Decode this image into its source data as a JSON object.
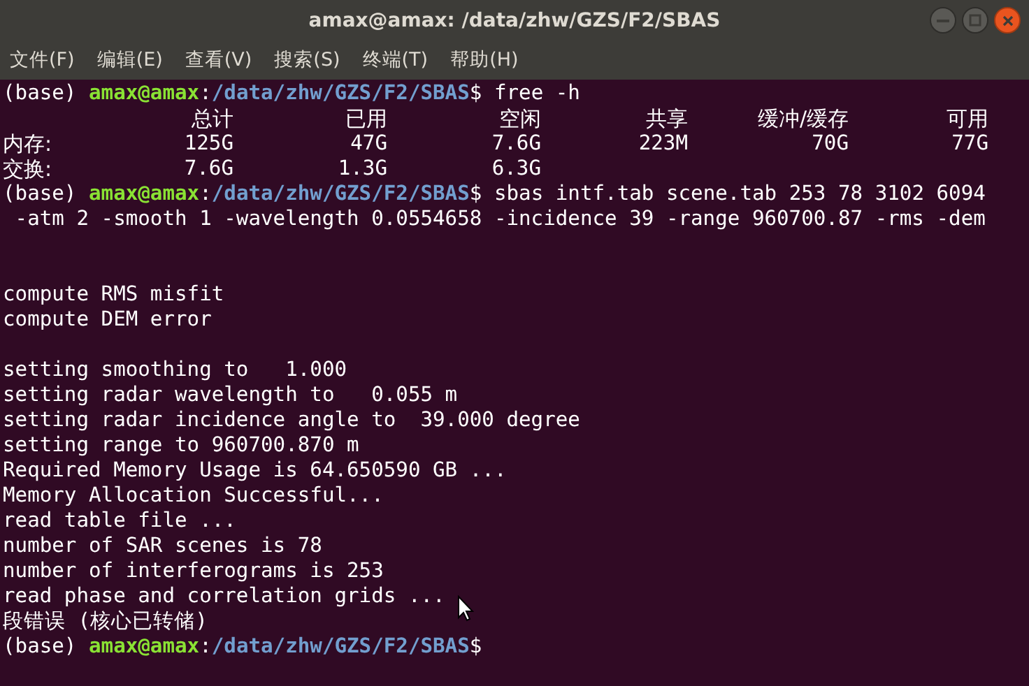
{
  "window": {
    "title": "amax@amax: /data/zhw/GZS/F2/SBAS"
  },
  "menu": [
    "文件(F)",
    "编辑(E)",
    "查看(V)",
    "搜索(S)",
    "终端(T)",
    "帮助(H)"
  ],
  "lines": [
    {
      "kind": "prompt",
      "segments": [
        {
          "kind": "env",
          "text": "(base)"
        },
        {
          "kind": "user",
          "text": "amax@amax"
        },
        {
          "kind": "sep",
          "text": ":"
        },
        {
          "kind": "path",
          "text": "/data/zhw/GZS/F2/SBAS"
        },
        {
          "kind": "sep",
          "text": "$"
        },
        {
          "kind": "command",
          "text": "free -h"
        }
      ]
    },
    {
      "kind": "free_header",
      "cells": [
        "总计",
        "已用",
        "空闲",
        "共享",
        "缓冲/缓存",
        "可用"
      ]
    },
    {
      "kind": "free_row",
      "label": "内存:",
      "cells": [
        "125G",
        "47G",
        "7.6G",
        "223M",
        "70G",
        "77G"
      ]
    },
    {
      "kind": "free_row",
      "label": "交换:",
      "cells": [
        "7.6G",
        "1.3G",
        "6.3G"
      ]
    },
    {
      "kind": "prompt",
      "segments": [
        {
          "kind": "env",
          "text": "(base)"
        },
        {
          "kind": "user",
          "text": "amax@amax"
        },
        {
          "kind": "sep",
          "text": ":"
        },
        {
          "kind": "path",
          "text": "/data/zhw/GZS/F2/SBAS"
        },
        {
          "kind": "sep",
          "text": "$"
        },
        {
          "kind": "command",
          "text": "sbas intf.tab scene.tab 253 78 3102 6094"
        }
      ]
    },
    {
      "kind": "continuation",
      "text": "-atm 2 -smooth 1 -wavelength 0.0554658 -incidence 39 -range 960700.87 -rms -dem"
    },
    {
      "kind": "blank"
    },
    {
      "kind": "blank"
    },
    {
      "kind": "text",
      "text": "compute RMS misfit"
    },
    {
      "kind": "text",
      "text": "compute DEM error"
    },
    {
      "kind": "blank"
    },
    {
      "kind": "text",
      "text": "setting smoothing to   1.000"
    },
    {
      "kind": "text",
      "text": "setting radar wavelength to   0.055 m"
    },
    {
      "kind": "text",
      "text": "setting radar incidence angle to  39.000 degree"
    },
    {
      "kind": "text",
      "text": "setting range to 960700.870 m"
    },
    {
      "kind": "text",
      "text": "Required Memory Usage is 64.650590 GB ..."
    },
    {
      "kind": "text",
      "text": "Memory Allocation Successful..."
    },
    {
      "kind": "text",
      "text": "read table file ..."
    },
    {
      "kind": "text",
      "text": "number of SAR scenes is 78"
    },
    {
      "kind": "text",
      "text": "number of interferograms is 253"
    },
    {
      "kind": "text",
      "text": "read phase and correlation grids ..."
    },
    {
      "kind": "text",
      "text": "段错误 (核心已转储)"
    },
    {
      "kind": "prompt",
      "segments": [
        {
          "kind": "env",
          "text": "(base)"
        },
        {
          "kind": "user",
          "text": "amax@amax"
        },
        {
          "kind": "sep",
          "text": ":"
        },
        {
          "kind": "path",
          "text": "/data/zhw/GZS/F2/SBAS"
        },
        {
          "kind": "sep",
          "text": "$"
        }
      ]
    }
  ]
}
